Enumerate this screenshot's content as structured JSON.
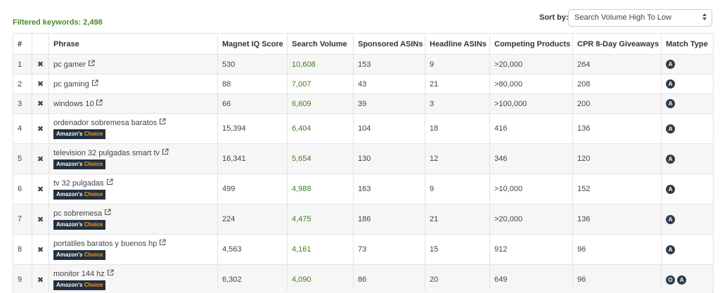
{
  "header": {
    "filtered_label": "Filtered keywords: 2,498",
    "sort_label": "Sort by:",
    "sort_selected": "Search Volume High To Low"
  },
  "table": {
    "columns": [
      "#",
      "",
      "Phrase",
      "Magnet IQ Score",
      "Search Volume",
      "Sponsored ASINs",
      "Headline ASINs",
      "Competing Products",
      "CPR 8-Day Giveaways",
      "Match Type"
    ],
    "badge": {
      "prefix": "Amazon's",
      "suffix": "Choice"
    },
    "remove_symbol": "✖",
    "rows": [
      {
        "idx": "1",
        "phrase": "pc gamer",
        "amazons_choice": false,
        "iq": "530",
        "volume": "10,608",
        "sponsored": "153",
        "headline": "9",
        "competing": ">20,000",
        "cpr": "264",
        "match": [
          "A"
        ]
      },
      {
        "idx": "2",
        "phrase": "pc gaming",
        "amazons_choice": false,
        "iq": "88",
        "volume": "7,007",
        "sponsored": "43",
        "headline": "21",
        "competing": ">80,000",
        "cpr": "208",
        "match": [
          "A"
        ]
      },
      {
        "idx": "3",
        "phrase": "windows 10",
        "amazons_choice": false,
        "iq": "66",
        "volume": "6,609",
        "sponsored": "39",
        "headline": "3",
        "competing": ">100,000",
        "cpr": "200",
        "match": [
          "A"
        ]
      },
      {
        "idx": "4",
        "phrase": "ordenador sobremesa baratos",
        "amazons_choice": true,
        "iq": "15,394",
        "volume": "6,404",
        "sponsored": "104",
        "headline": "18",
        "competing": "416",
        "cpr": "136",
        "match": [
          "A"
        ]
      },
      {
        "idx": "5",
        "phrase": "television 32 pulgadas smart tv",
        "amazons_choice": true,
        "iq": "16,341",
        "volume": "5,654",
        "sponsored": "130",
        "headline": "12",
        "competing": "346",
        "cpr": "120",
        "match": [
          "A"
        ]
      },
      {
        "idx": "6",
        "phrase": "tv 32 pulgadas",
        "amazons_choice": true,
        "iq": "499",
        "volume": "4,988",
        "sponsored": "163",
        "headline": "9",
        "competing": ">10,000",
        "cpr": "152",
        "match": [
          "A"
        ]
      },
      {
        "idx": "7",
        "phrase": "pc sobremesa",
        "amazons_choice": true,
        "iq": "224",
        "volume": "4,475",
        "sponsored": "186",
        "headline": "21",
        "competing": ">20,000",
        "cpr": "136",
        "match": [
          "A"
        ]
      },
      {
        "idx": "8",
        "phrase": "portatiles baratos y buenos hp",
        "amazons_choice": true,
        "iq": "4,563",
        "volume": "4,161",
        "sponsored": "73",
        "headline": "15",
        "competing": "912",
        "cpr": "96",
        "match": [
          "A"
        ]
      },
      {
        "idx": "9",
        "phrase": "monitor 144 hz",
        "amazons_choice": true,
        "iq": "6,302",
        "volume": "4,090",
        "sponsored": "86",
        "headline": "20",
        "competing": "649",
        "cpr": "96",
        "match": [
          "O",
          "A"
        ]
      }
    ]
  },
  "colors": {
    "accent_green": "#3d7f20",
    "badge_bg": "#232f3e",
    "badge_choice": "#f39c1f",
    "match_badge": "#2f3d4d"
  }
}
